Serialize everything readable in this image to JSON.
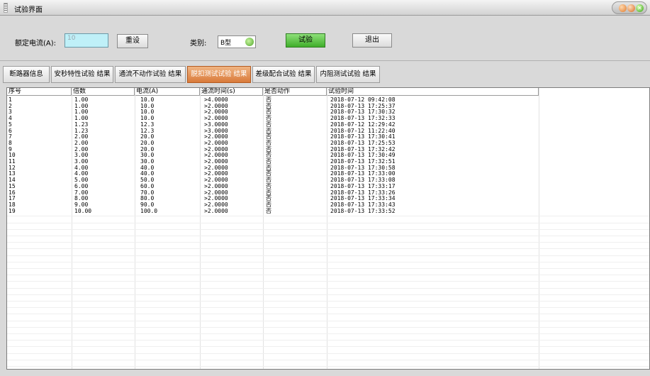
{
  "window": {
    "title": "试验界面"
  },
  "controls": {
    "rated_current_label": "额定电流(A):",
    "rated_current_value": "10",
    "reset_label": "重设",
    "type_label": "类别:",
    "type_value": "B型",
    "test_label": "试验",
    "exit_label": "退出"
  },
  "tabs": [
    {
      "label": "断路器信息"
    },
    {
      "label": "安秒特性试验 结果"
    },
    {
      "label": "通流不动作试验 结果"
    },
    {
      "label": "脱扣测试试验 结果"
    },
    {
      "label": "差级配合试验 结果"
    },
    {
      "label": "内阻测试试验 结果"
    }
  ],
  "table": {
    "columns": [
      "序号",
      "倍数",
      "电流(A)",
      "通流时间(s)",
      "是否动作",
      "试验时间"
    ],
    "rows": [
      [
        "1",
        "1.00",
        "10.0",
        ">4.0000",
        "否",
        "2018-07-12 09:42:08"
      ],
      [
        "2",
        "1.00",
        "10.0",
        ">2.0000",
        "否",
        "2018-07-13 17:25:37"
      ],
      [
        "3",
        "1.00",
        "10.0",
        ">2.0000",
        "否",
        "2018-07-13 17:30:32"
      ],
      [
        "4",
        "1.00",
        "10.0",
        ">2.0000",
        "否",
        "2018-07-13 17:32:33"
      ],
      [
        "5",
        "1.23",
        "12.3",
        ">3.0000",
        "否",
        "2018-07-12 12:29:42"
      ],
      [
        "6",
        "1.23",
        "12.3",
        ">3.0000",
        "否",
        "2018-07-12 11:22:40"
      ],
      [
        "7",
        "2.00",
        "20.0",
        ">2.0000",
        "否",
        "2018-07-13 17:30:41"
      ],
      [
        "8",
        "2.00",
        "20.0",
        ">2.0000",
        "否",
        "2018-07-13 17:25:53"
      ],
      [
        "9",
        "2.00",
        "20.0",
        ">2.0000",
        "否",
        "2018-07-13 17:32:42"
      ],
      [
        "10",
        "3.00",
        "30.0",
        ">2.0000",
        "否",
        "2018-07-13 17:30:49"
      ],
      [
        "11",
        "3.00",
        "30.0",
        ">2.0000",
        "否",
        "2018-07-13 17:32:51"
      ],
      [
        "12",
        "4.00",
        "40.0",
        ">2.0000",
        "否",
        "2018-07-13 17:30:58"
      ],
      [
        "13",
        "4.00",
        "40.0",
        ">2.0000",
        "否",
        "2018-07-13 17:33:00"
      ],
      [
        "14",
        "5.00",
        "50.0",
        ">2.0000",
        "否",
        "2018-07-13 17:33:08"
      ],
      [
        "15",
        "6.00",
        "60.0",
        ">2.0000",
        "否",
        "2018-07-13 17:33:17"
      ],
      [
        "16",
        "7.00",
        "70.0",
        ">2.0000",
        "否",
        "2018-07-13 17:33:26"
      ],
      [
        "17",
        "8.00",
        "80.0",
        ">2.0000",
        "否",
        "2018-07-13 17:33:34"
      ],
      [
        "18",
        "9.00",
        "90.0",
        ">2.0000",
        "否",
        "2018-07-13 17:33:43"
      ],
      [
        "19",
        "10.00",
        "100.0",
        ">2.0000",
        "否",
        "2018-07-13 17:33:52"
      ]
    ]
  },
  "colors": {
    "active_tab": "#d97a3a",
    "test_button": "#3fae2a",
    "input_bg": "#bff0f8"
  }
}
